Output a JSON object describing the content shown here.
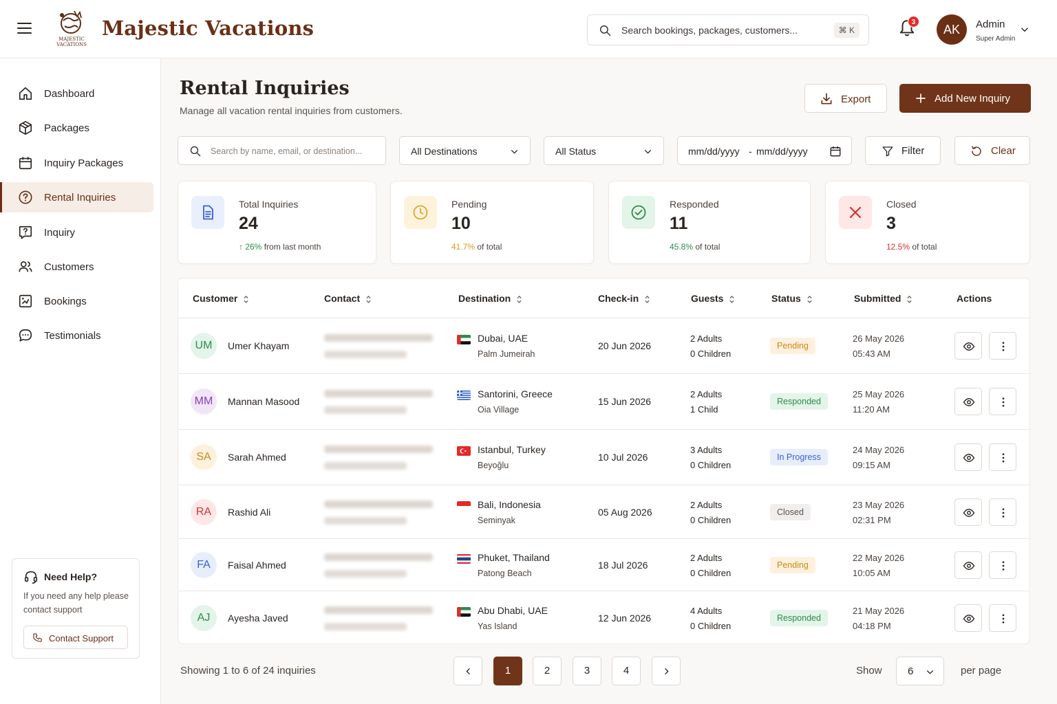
{
  "app": {
    "brand": "Majestic Vacations",
    "logo_text": "MAJESTIC VACATIONS",
    "brand_color": "#6b2f16",
    "search_placeholder": "Search bookings, packages, customers...",
    "search_shortcut": "⌘ K",
    "notifications_count": "3",
    "user": {
      "initials": "AK",
      "name": "Admin",
      "role": "Super Admin"
    }
  },
  "sidebar": {
    "items": [
      {
        "label": "Dashboard",
        "icon": "home-icon"
      },
      {
        "label": "Packages",
        "icon": "package-icon"
      },
      {
        "label": "Inquiry Packages",
        "icon": "calendar-icon"
      },
      {
        "label": "Rental Inquiries",
        "icon": "help-circle-icon",
        "active": true
      },
      {
        "label": "Inquiry",
        "icon": "question-square-icon"
      },
      {
        "label": "Customers",
        "icon": "users-icon"
      },
      {
        "label": "Bookings",
        "icon": "bookings-icon"
      },
      {
        "label": "Testimonials",
        "icon": "chat-icon"
      }
    ],
    "help": {
      "title": "Need Help?",
      "body": "If you need any help please contact support",
      "button": "Contact Support"
    }
  },
  "page": {
    "title": "Rental Inquiries",
    "subtitle": "Manage all vacation rental inquiries from customers.",
    "export_label": "Export",
    "add_label": "Add New Inquiry"
  },
  "filters": {
    "search_placeholder": "Search by name, email, or destination...",
    "destination": "All Destinations",
    "status": "All Status",
    "date_from": "mm/dd/yyyy",
    "date_sep": "-",
    "date_to": "mm/dd/yyyy",
    "filter_label": "Filter",
    "clear_label": "Clear"
  },
  "stats": [
    {
      "label": "Total Inquiries",
      "value": "24",
      "highlight": "↑ 26%",
      "rest": " from last month",
      "color": "#2e8b4e",
      "icon": "document-icon"
    },
    {
      "label": "Pending",
      "value": "10",
      "highlight": "41.7%",
      "rest": " of total",
      "color": "#d89a1c",
      "icon": "clock-icon"
    },
    {
      "label": "Responded",
      "value": "11",
      "highlight": "45.8%",
      "rest": " of total",
      "color": "#2e8b4e",
      "icon": "check-circle-icon"
    },
    {
      "label": "Closed",
      "value": "3",
      "highlight": "12.5%",
      "rest": " of total",
      "color": "#d93030",
      "icon": "x-icon"
    }
  ],
  "table": {
    "columns": [
      "Customer",
      "Contact",
      "Destination",
      "Check-in",
      "Guests",
      "Status",
      "Submitted",
      "Actions"
    ],
    "rows": [
      {
        "initials": "UM",
        "name": "Umer Khayam",
        "destination": "Dubai, UAE",
        "area": "Palm Jumeirah",
        "flag": "uae",
        "checkin": "20 Jun 2026",
        "adults": "2 Adults",
        "children": "0 Children",
        "status": "Pending",
        "date": "26 May 2026",
        "time": "05:43 AM"
      },
      {
        "initials": "MM",
        "name": "Mannan Masood",
        "destination": "Santorini, Greece",
        "area": "Oia Village",
        "flag": "greece",
        "checkin": "15 Jun 2026",
        "adults": "2 Adults",
        "children": "1 Child",
        "status": "Responded",
        "date": "25 May 2026",
        "time": "11:20 AM"
      },
      {
        "initials": "SA",
        "name": "Sarah Ahmed",
        "destination": "Istanbul, Turkey",
        "area": "Beyoğlu",
        "flag": "turkey",
        "checkin": "10 Jul 2026",
        "adults": "3 Adults",
        "children": "0 Children",
        "status": "In Progress",
        "date": "24 May 2026",
        "time": "09:15 AM"
      },
      {
        "initials": "RA",
        "name": "Rashid Ali",
        "destination": "Bali, Indonesia",
        "area": "Seminyak",
        "flag": "indonesia",
        "checkin": "05 Aug 2026",
        "adults": "2 Adults",
        "children": "0 Children",
        "status": "Closed",
        "date": "23 May 2026",
        "time": "02:31 PM"
      },
      {
        "initials": "FA",
        "name": "Faisal Ahmed",
        "destination": "Phuket, Thailand",
        "area": "Patong Beach",
        "flag": "thailand",
        "checkin": "18 Jul 2026",
        "adults": "2 Adults",
        "children": "0 Children",
        "status": "Pending",
        "date": "22 May 2026",
        "time": "10:05 AM"
      },
      {
        "initials": "AJ",
        "name": "Ayesha Javed",
        "destination": "Abu Dhabi, UAE",
        "area": "Yas Island",
        "flag": "uae",
        "checkin": "12 Jun 2026",
        "adults": "4 Adults",
        "children": "0 Children",
        "status": "Responded",
        "date": "21 May 2026",
        "time": "04:18 PM"
      }
    ]
  },
  "pagination": {
    "summary": "Showing 1 to 6 of 24 inquiries",
    "pages": [
      "1",
      "2",
      "3",
      "4"
    ],
    "current": "1",
    "show_label": "Show",
    "per_page": "6",
    "per_page_label": "per page"
  }
}
